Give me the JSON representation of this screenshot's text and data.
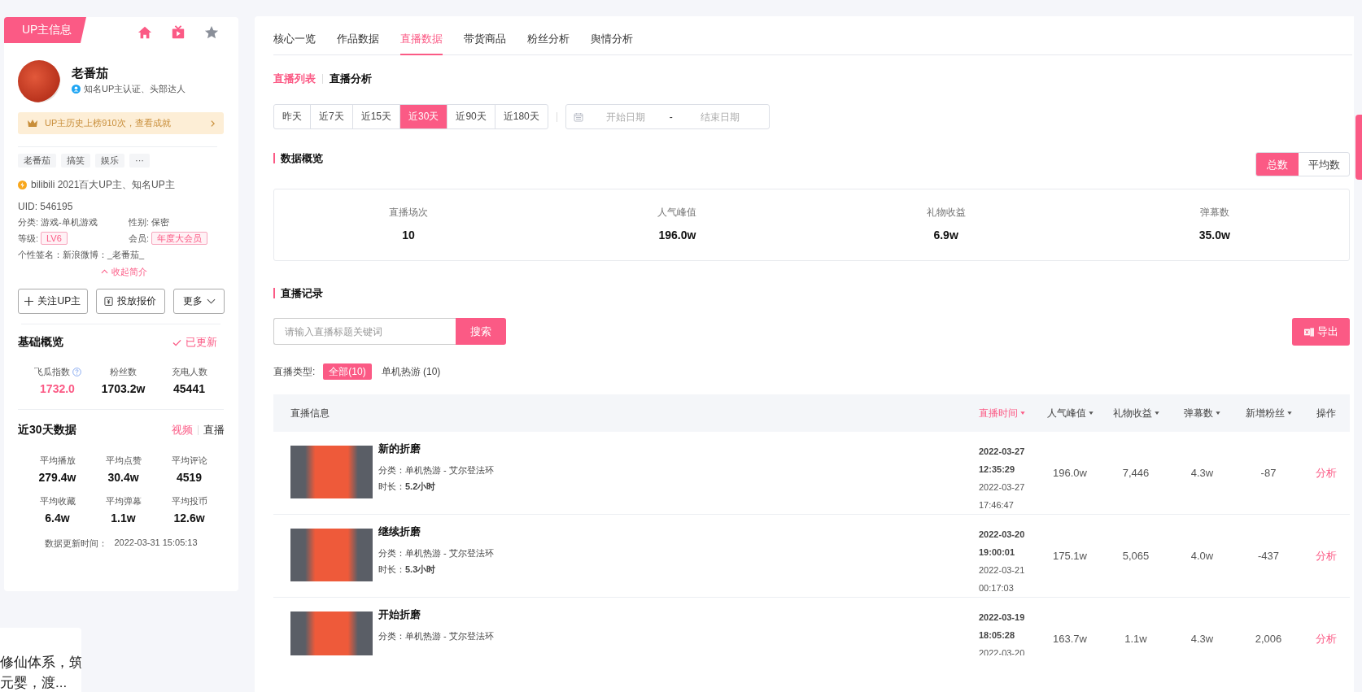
{
  "profile": {
    "tag": "UP主信息",
    "name": "老番茄",
    "verification": "知名UP主认证、头部达人",
    "achievement": "UP主历史上榜910次，查看成就",
    "tags": [
      "老番茄",
      "搞笑",
      "娱乐",
      "···"
    ],
    "honor": "bilibili 2021百大UP主、知名UP主",
    "uid": "UID: 546195",
    "fields": [
      {
        "label": "分类:",
        "value": "游戏-单机游戏",
        "kind": "text"
      },
      {
        "label": "性别:",
        "value": "保密",
        "kind": "text"
      },
      {
        "label": "等级:",
        "value": "LV6",
        "kind": "badge"
      },
      {
        "label": "会员:",
        "value": "年度大会员",
        "kind": "badge"
      }
    ],
    "signature": "个性签名：新浪微博：_老番茄_",
    "collapse": "收起简介",
    "buttons": [
      {
        "label": "关注UP主",
        "kind": "follow"
      },
      {
        "label": "投放报价",
        "kind": "quote"
      },
      {
        "label": "更多",
        "kind": "more"
      }
    ]
  },
  "basic_overview": {
    "title": "基础概览",
    "status": "已更新",
    "stats": [
      {
        "label": "飞瓜指数",
        "value": "1732.0",
        "help": true,
        "highlight": true
      },
      {
        "label": "粉丝数",
        "value": "1703.2w",
        "help": false,
        "highlight": false
      },
      {
        "label": "充电人数",
        "value": "45441",
        "help": false,
        "highlight": false
      }
    ]
  },
  "recent_data": {
    "title": "近30天数据",
    "modes": [
      {
        "label": "视频",
        "selected": true
      },
      {
        "label": "直播",
        "selected": false
      }
    ],
    "stats": [
      {
        "label": "平均播放",
        "value": "279.4w"
      },
      {
        "label": "平均点赞",
        "value": "30.4w"
      },
      {
        "label": "平均评论",
        "value": "4519"
      },
      {
        "label": "平均收藏",
        "value": "6.4w"
      },
      {
        "label": "平均弹幕",
        "value": "1.1w"
      },
      {
        "label": "平均投币",
        "value": "12.6w"
      }
    ],
    "updated_label": "数据更新时间：",
    "updated_value": "2022-03-31 15:05:13"
  },
  "partial_card": {
    "lines": [
      "修仙体系，筑",
      "元婴，渡..."
    ]
  },
  "main": {
    "tabs": [
      {
        "label": "核心一览",
        "selected": false
      },
      {
        "label": "作品数据",
        "selected": false
      },
      {
        "label": "直播数据",
        "selected": true
      },
      {
        "label": "带货商品",
        "selected": false
      },
      {
        "label": "粉丝分析",
        "selected": false
      },
      {
        "label": "舆情分析",
        "selected": false
      }
    ],
    "sub_tabs": [
      {
        "label": "直播列表",
        "selected": true
      },
      {
        "label": "直播分析",
        "selected": false
      }
    ],
    "ranges": [
      {
        "label": "昨天",
        "selected": false
      },
      {
        "label": "近7天",
        "selected": false
      },
      {
        "label": "近15天",
        "selected": false
      },
      {
        "label": "近30天",
        "selected": true
      },
      {
        "label": "近90天",
        "selected": false
      },
      {
        "label": "近180天",
        "selected": false
      }
    ],
    "date_range": {
      "start_placeholder": "开始日期",
      "separator": "-",
      "end_placeholder": "结束日期"
    },
    "overview": {
      "title": "数据概览",
      "modes": [
        {
          "label": "总数",
          "selected": true
        },
        {
          "label": "平均数",
          "selected": false
        }
      ],
      "stats": [
        {
          "label": "直播场次",
          "value": "10"
        },
        {
          "label": "人气峰值",
          "value": "196.0w"
        },
        {
          "label": "礼物收益",
          "value": "6.9w"
        },
        {
          "label": "弹幕数",
          "value": "35.0w"
        }
      ]
    },
    "records": {
      "title": "直播记录",
      "search": {
        "placeholder": "请输入直播标题关键词",
        "button": "搜索"
      },
      "export": "导出",
      "filter": {
        "label": "直播类型:",
        "options": [
          {
            "label": "全部(10)",
            "selected": true
          },
          {
            "label": "单机热游 (10)",
            "selected": false
          }
        ]
      },
      "columns": [
        {
          "label": "直播信息",
          "sortable": false,
          "selected": false
        },
        {
          "label": "直播时间",
          "sortable": true,
          "selected": true
        },
        {
          "label": "人气峰值",
          "sortable": true,
          "selected": false
        },
        {
          "label": "礼物收益",
          "sortable": true,
          "selected": false
        },
        {
          "label": "弹幕数",
          "sortable": true,
          "selected": false
        },
        {
          "label": "新增粉丝",
          "sortable": true,
          "selected": false
        },
        {
          "label": "操作",
          "sortable": false,
          "selected": false
        }
      ],
      "rows": [
        {
          "title": "新的折磨",
          "category": "分类：单机热游 - 艾尔登法环",
          "duration": "时长：**5.2小时**",
          "start": [
            "2022-03-27",
            "12:35:29"
          ],
          "end": [
            "2022-03-27",
            "17:46:47"
          ],
          "peak": "196.0w",
          "gift": "7,446",
          "danmaku": "4.3w",
          "new_fans": "-87",
          "action": "分析"
        },
        {
          "title": "继续折磨",
          "category": "分类：单机热游 - 艾尔登法环",
          "duration": "时长：**5.3小时**",
          "start": [
            "2022-03-20",
            "19:00:01"
          ],
          "end": [
            "2022-03-21",
            "00:17:03"
          ],
          "peak": "175.1w",
          "gift": "5,065",
          "danmaku": "4.0w",
          "new_fans": "-437",
          "action": "分析"
        },
        {
          "title": "开始折磨",
          "category": "分类：单机热游 - 艾尔登法环",
          "start": [
            "2022-03-19",
            "18:05:28"
          ],
          "end": [
            "2022-03-20"
          ],
          "peak": "163.7w",
          "gift": "1.1w",
          "danmaku": "4.3w",
          "new_fans": "2,006",
          "action": "分析"
        }
      ]
    }
  }
}
